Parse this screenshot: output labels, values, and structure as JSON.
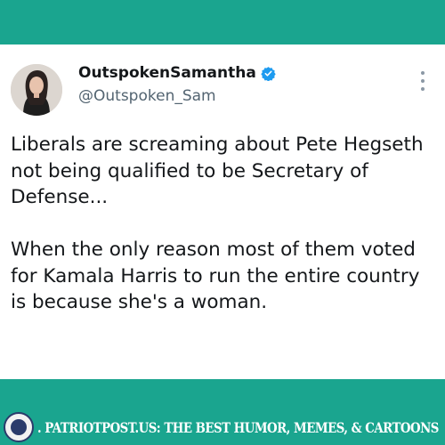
{
  "post": {
    "display_name": "OutspokenSamantha",
    "handle": "@Outspoken_Sam",
    "verified": true,
    "paragraphs": [
      "Liberals are screaming about Pete Hegseth not being qualified to be Secretary of Defense...",
      "When the only reason most of them voted for Kamala Harris to run the entire country is because she's a woman."
    ]
  },
  "footer": {
    "text": ". PATRIOTPOST.US: THE BEST HUMOR, MEMES, & CARTOONS"
  },
  "colors": {
    "background": "#1aa58f",
    "card": "#ffffff",
    "verified_badge": "#1d9bf0",
    "handle": "#536471"
  },
  "icons": [
    "avatar",
    "verified-badge-icon",
    "more-options-icon",
    "patriot-post-seal-icon"
  ]
}
